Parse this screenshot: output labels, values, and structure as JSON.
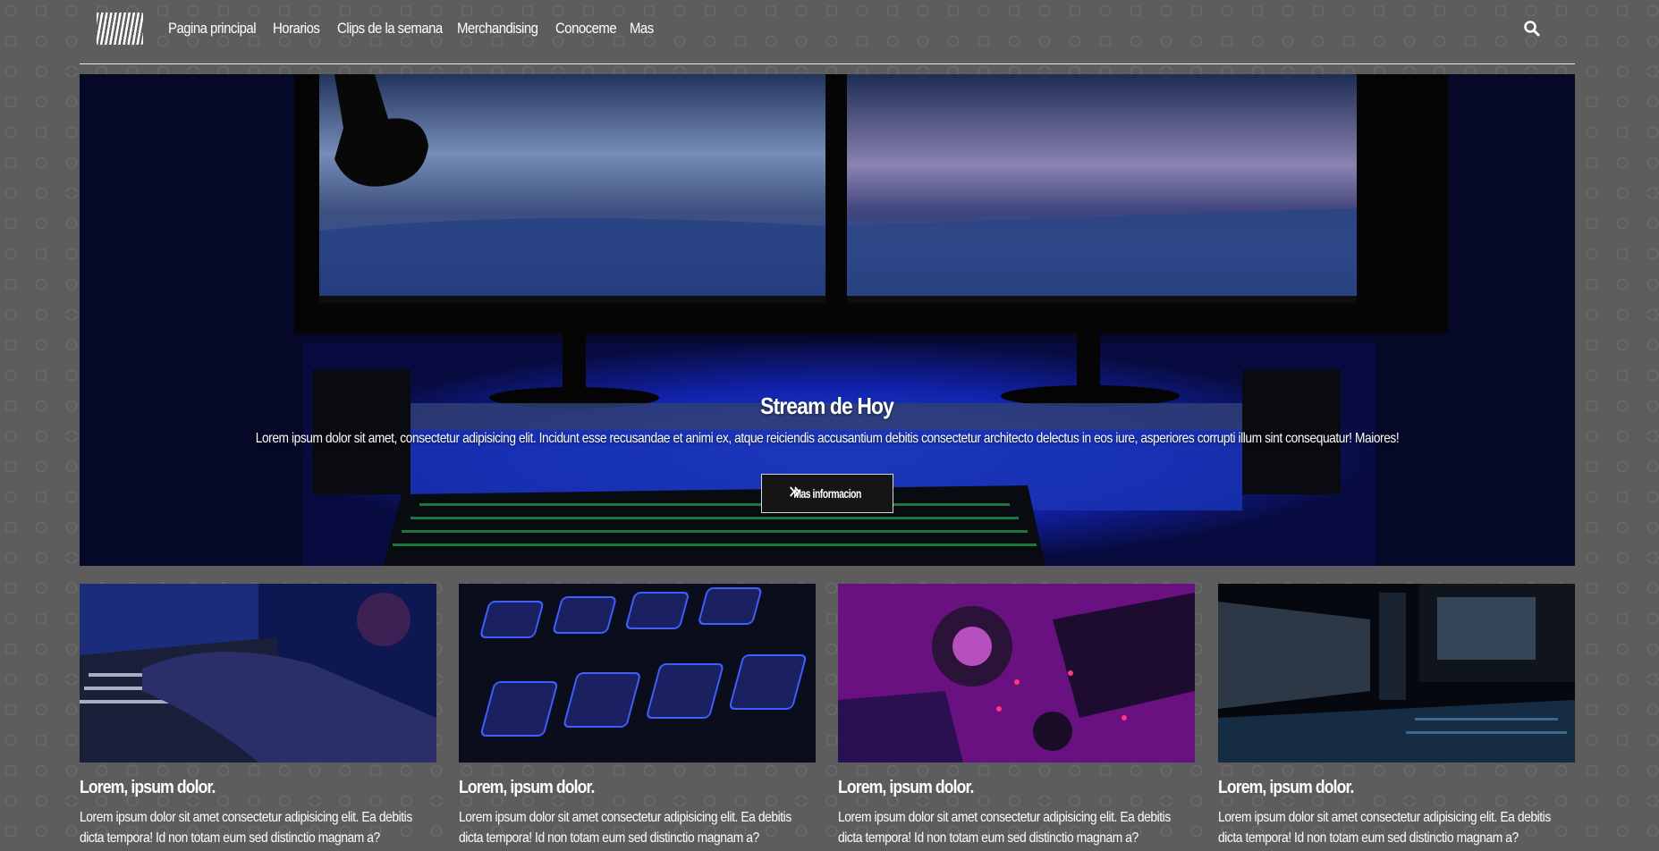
{
  "nav": {
    "logo": "logo",
    "links": [
      "Pagina principal",
      "Horarios",
      "Clips de la semana",
      "Merchandising",
      "Conoceme",
      "Mas"
    ],
    "search_icon": "search-icon"
  },
  "hero": {
    "title": "Stream de Hoy",
    "text": "Lorem ipsum dolor sit amet, consectetur adipisicing elit. Incidunt esse recusandae et animi ex, atque reiciendis accusantium debitis consectetur architecto delectus in eos iure, asperiores corrupti illum sint consequatur! Maiores!",
    "button_label": "Mas informacion",
    "button_icon": "double-chevron-right-icon"
  },
  "cards": [
    {
      "title": "Lorem, ipsum dolor.",
      "text": "Lorem ipsum dolor sit amet consectetur adipisicing elit. Ea debitis dicta tempora! Id non totam eum sed distinctio magnam a?"
    },
    {
      "title": "Lorem, ipsum dolor.",
      "text": "Lorem ipsum dolor sit amet consectetur adipisicing elit. Ea debitis dicta tempora! Id non totam eum sed distinctio magnam a?"
    },
    {
      "title": "Lorem, ipsum dolor.",
      "text": "Lorem ipsum dolor sit amet consectetur adipisicing elit. Ea debitis dicta tempora! Id non totam eum sed distinctio magnam a?"
    },
    {
      "title": "Lorem, ipsum dolor.",
      "text": "Lorem ipsum dolor sit amet consectetur adipisicing elit. Ea debitis dicta tempora! Id non totam eum sed distinctio magnam a?"
    }
  ],
  "colors": {
    "background": "#5d5d5d",
    "hero_button_bg": "#151515",
    "text": "#ffffff"
  }
}
